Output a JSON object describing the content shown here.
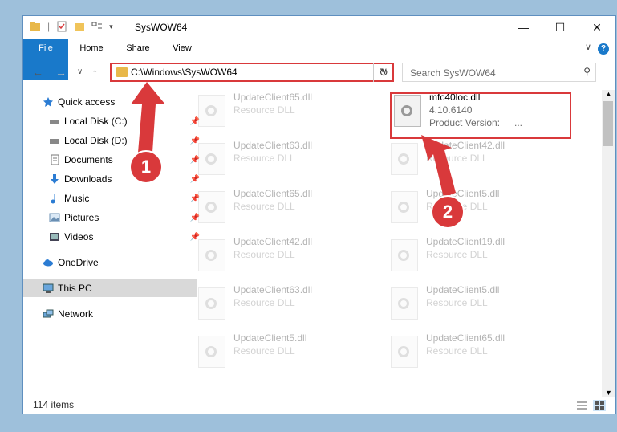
{
  "window": {
    "title": "SysWOW64"
  },
  "ribbon": {
    "tabs": [
      "File",
      "Home",
      "Share",
      "View"
    ],
    "help": "?"
  },
  "address": {
    "path": "C:\\Windows\\SysWOW64"
  },
  "search": {
    "placeholder": "Search SysWOW64"
  },
  "sidebar": {
    "items": [
      {
        "label": "Quick access",
        "icon": "star-icon"
      },
      {
        "label": "Local Disk (C:)",
        "icon": "drive-icon"
      },
      {
        "label": "Local Disk (D:)",
        "icon": "drive-icon"
      },
      {
        "label": "Documents",
        "icon": "documents-icon"
      },
      {
        "label": "Downloads",
        "icon": "download-icon"
      },
      {
        "label": "Music",
        "icon": "music-icon"
      },
      {
        "label": "Pictures",
        "icon": "pictures-icon"
      },
      {
        "label": "Videos",
        "icon": "videos-icon"
      },
      {
        "label": "OneDrive",
        "icon": "cloud-icon"
      },
      {
        "label": "This PC",
        "icon": "pc-icon"
      },
      {
        "label": "Network",
        "icon": "network-icon"
      }
    ]
  },
  "files": [
    {
      "name": "UpdateClient65.dll",
      "type": "Resource DLL"
    },
    {
      "name": "mfc40loc.dll",
      "version": "4.10.6140",
      "product_label": "Product Version:",
      "product_value": "..."
    },
    {
      "name": "UpdateClient63.dll",
      "type": "Resource DLL"
    },
    {
      "name": "UpdateClient42.dll",
      "type": "Resource DLL"
    },
    {
      "name": "UpdateClient65.dll",
      "type": "Resource DLL"
    },
    {
      "name": "UpdateClient5.dll",
      "type": "Resource DLL"
    },
    {
      "name": "UpdateClient42.dll",
      "type": "Resource DLL"
    },
    {
      "name": "UpdateClient19.dll",
      "type": "Resource DLL"
    },
    {
      "name": "UpdateClient63.dll",
      "type": "Resource DLL"
    },
    {
      "name": "UpdateClient5.dll",
      "type": "Resource DLL"
    },
    {
      "name": "UpdateClient5.dll",
      "type": "Resource DLL"
    },
    {
      "name": "UpdateClient65.dll",
      "type": "Resource DLL"
    }
  ],
  "status": {
    "count": "114 items"
  },
  "callouts": {
    "one": "1",
    "two": "2"
  },
  "colors": {
    "accent": "#1979ca",
    "highlight": "#d9393b"
  }
}
